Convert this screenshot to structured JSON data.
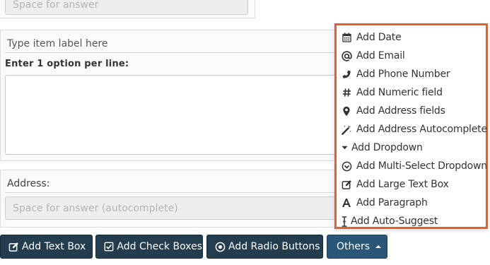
{
  "top_field": {
    "placeholder": "Space for answer"
  },
  "dropdown_item": {
    "label_placeholder": "Type item label here",
    "options_label": "Enter 1 option per line:",
    "options_value": ""
  },
  "address_item": {
    "label": "Address:",
    "placeholder": "Space for answer (autocomplete)"
  },
  "buttons": {
    "add_text_box": "Add Text Box",
    "add_check_boxes": "Add Check Boxes",
    "add_radio_buttons": "Add Radio Buttons",
    "others": "Others"
  },
  "others_menu": {
    "items": [
      {
        "label": "Add Date",
        "icon": "calendar-icon"
      },
      {
        "label": "Add Email",
        "icon": "at-sign-icon"
      },
      {
        "label": "Add Phone Number",
        "icon": "phone-icon"
      },
      {
        "label": "Add Numeric field",
        "icon": "hashtag-icon"
      },
      {
        "label": "Add Address fields",
        "icon": "map-marker-icon"
      },
      {
        "label": "Add Address Autocomplete",
        "icon": "magic-wand-icon"
      },
      {
        "label": "Add Dropdown",
        "icon": "caret-down-icon"
      },
      {
        "label": "Add Multi-Select Dropdown",
        "icon": "chevron-circle-down-icon"
      },
      {
        "label": "Add Large Text Box",
        "icon": "edit-icon"
      },
      {
        "label": "Add Paragraph",
        "icon": "font-letter-icon"
      },
      {
        "label": "Add Auto-Suggest",
        "icon": "text-cursor-icon"
      }
    ]
  },
  "colors": {
    "button_bg": "#233d4f",
    "others_button_bg": "#2a5678",
    "menu_highlight_border": "#e0622b"
  }
}
